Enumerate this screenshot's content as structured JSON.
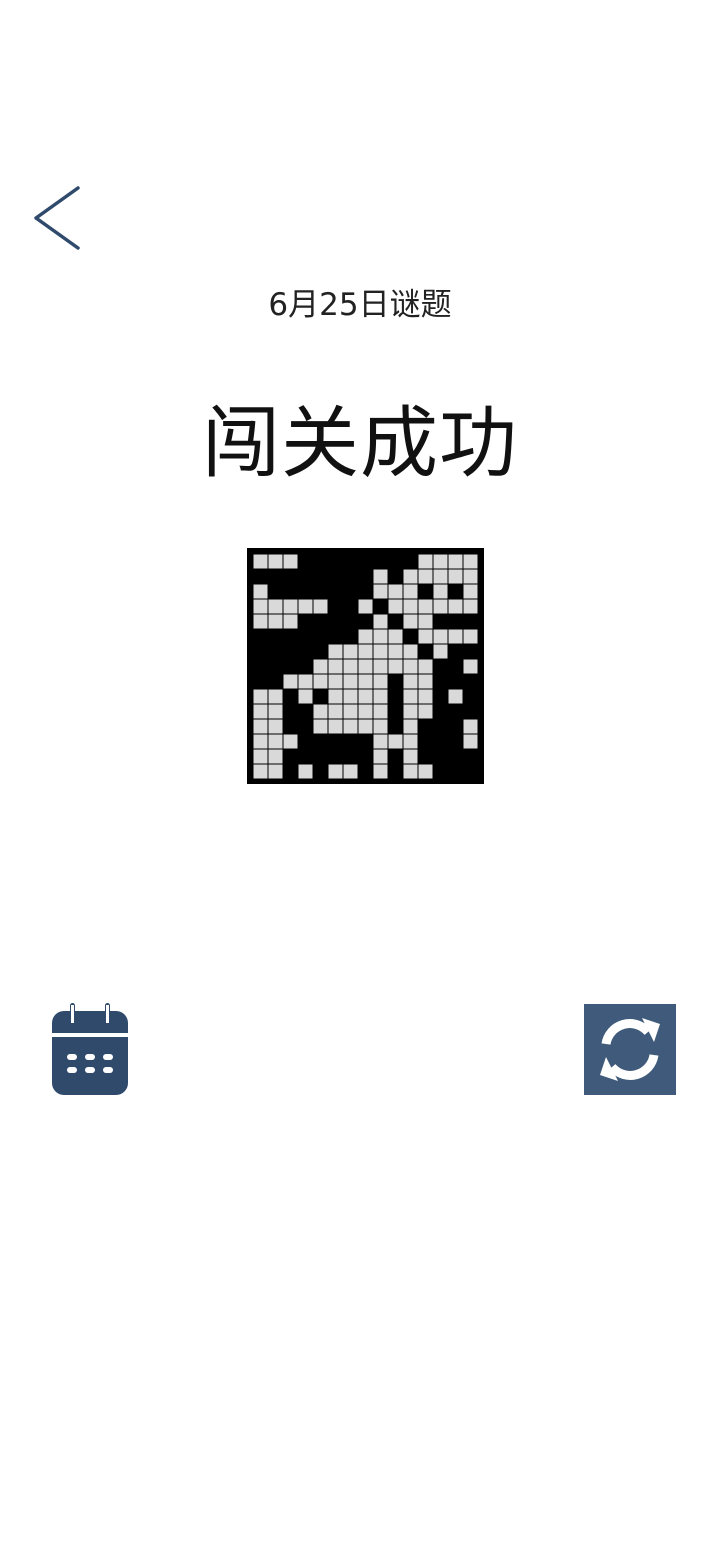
{
  "header": {
    "subtitle": "6月25日谜题",
    "title": "闯关成功"
  },
  "icons": {
    "back": "chevron-left-icon",
    "calendar": "calendar-icon",
    "refresh": "refresh-icon"
  },
  "colors": {
    "accent": "#2f4a6b",
    "refresh_bg": "#3f5a7a",
    "cell_empty": "#d9d9d9",
    "cell_filled": "#000000"
  },
  "puzzle": {
    "rows": 15,
    "cols": 15,
    "grid": [
      "000111111110000",
      "111111110100000",
      "011111110001010",
      "000001101000000",
      "000111110100111",
      "111111100010000",
      "111110000001011",
      "111100000000110",
      "110000000100111",
      "001010000100101",
      "001100000100111",
      "001100000101110",
      "000111110001110",
      "001111110101111",
      "001010010100111"
    ]
  }
}
